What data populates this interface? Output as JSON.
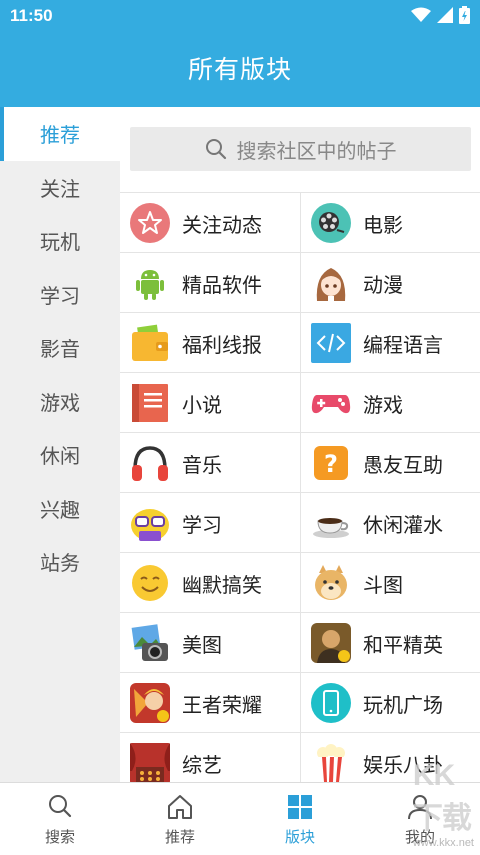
{
  "status_bar": {
    "time": "11:50"
  },
  "app_bar": {
    "title": "所有版块"
  },
  "sidebar": {
    "items": [
      {
        "label": "推荐",
        "active": true
      },
      {
        "label": "关注",
        "active": false
      },
      {
        "label": "玩机",
        "active": false
      },
      {
        "label": "学习",
        "active": false
      },
      {
        "label": "影音",
        "active": false
      },
      {
        "label": "游戏",
        "active": false
      },
      {
        "label": "休闲",
        "active": false
      },
      {
        "label": "兴趣",
        "active": false
      },
      {
        "label": "站务",
        "active": false
      }
    ]
  },
  "search": {
    "placeholder": "搜索社区中的帖子"
  },
  "boards": [
    {
      "label": "关注动态",
      "icon": "star-badge-icon"
    },
    {
      "label": "电影",
      "icon": "film-reel-icon"
    },
    {
      "label": "精品软件",
      "icon": "android-icon"
    },
    {
      "label": "动漫",
      "icon": "anime-girl-icon"
    },
    {
      "label": "福利线报",
      "icon": "wallet-icon"
    },
    {
      "label": "编程语言",
      "icon": "code-icon"
    },
    {
      "label": "小说",
      "icon": "book-icon"
    },
    {
      "label": "游戏",
      "icon": "gamepad-icon"
    },
    {
      "label": "音乐",
      "icon": "headphones-icon"
    },
    {
      "label": "愚友互助",
      "icon": "question-icon"
    },
    {
      "label": "学习",
      "icon": "nerd-face-icon"
    },
    {
      "label": "休闲灌水",
      "icon": "coffee-cup-icon"
    },
    {
      "label": "幽默搞笑",
      "icon": "smile-face-icon"
    },
    {
      "label": "斗图",
      "icon": "doge-icon"
    },
    {
      "label": "美图",
      "icon": "photo-camera-icon"
    },
    {
      "label": "和平精英",
      "icon": "game-avatar-icon"
    },
    {
      "label": "王者荣耀",
      "icon": "game-hero-icon"
    },
    {
      "label": "玩机广场",
      "icon": "phone-icon"
    },
    {
      "label": "综艺",
      "icon": "theater-icon"
    },
    {
      "label": "娱乐八卦",
      "icon": "popcorn-icon"
    }
  ],
  "tabs": [
    {
      "label": "搜索",
      "icon": "search-icon",
      "active": false
    },
    {
      "label": "推荐",
      "icon": "home-icon",
      "active": false
    },
    {
      "label": "版块",
      "icon": "grid-icon",
      "active": true
    },
    {
      "label": "我的",
      "icon": "user-icon",
      "active": false
    }
  ],
  "watermark": {
    "text": "www.kkx.net",
    "brand": "KK下载"
  },
  "colors": {
    "accent": "#34ace0",
    "active_text": "#2b9fd8"
  }
}
